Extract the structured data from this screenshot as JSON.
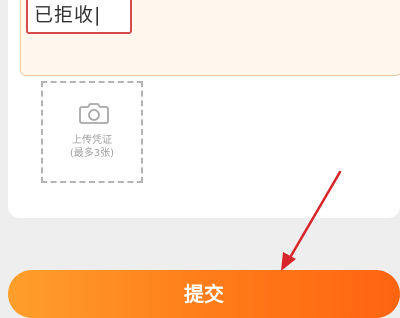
{
  "reason": {
    "value": "已拒收|"
  },
  "upload": {
    "icon": "camera-icon",
    "line1": "上传凭证",
    "line2": "(最多3张)"
  },
  "submit": {
    "label": "提交"
  },
  "annotation": {
    "arrow_color": "#d8252b"
  },
  "colors": {
    "accent_start": "#ff9f2b",
    "accent_end": "#ff6410",
    "input_border": "#d84b4b"
  }
}
